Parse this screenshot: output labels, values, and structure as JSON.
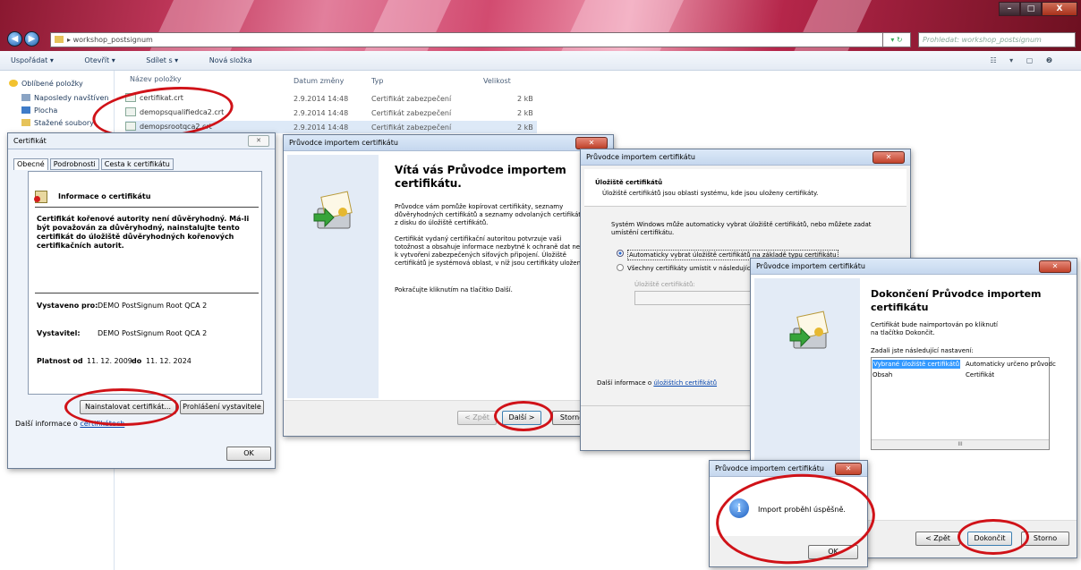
{
  "window": {
    "breadcrumb_separator": "▸",
    "path": "workshop_postsignum",
    "search_placeholder": "Prohledat: workshop_postsignum",
    "controls": {
      "minimize": "–",
      "maximize": "□",
      "close": "X"
    }
  },
  "toolbar": {
    "organize": "Uspořádat ▾",
    "open": "Otevřít ▾",
    "share": "Sdílet s ▾",
    "new_folder": "Nová složka",
    "view_icons": "☷ ▾ ▢ ❷"
  },
  "sidebar": {
    "items": [
      {
        "label": "Oblíbené položky",
        "icon": "star-icon"
      },
      {
        "label": "Naposledy navštíven",
        "icon": "recent-icon"
      },
      {
        "label": "Plocha",
        "icon": "desktop-icon"
      },
      {
        "label": "Stažené soubory",
        "icon": "downloads-icon"
      }
    ]
  },
  "file_list": {
    "columns": [
      "Název položky",
      "Datum změny",
      "Typ",
      "Velikost"
    ],
    "rows": [
      {
        "name": "certifikat.crt",
        "date": "2.9.2014 14:48",
        "type": "Certifikát zabezpečení",
        "size": "2 kB"
      },
      {
        "name": "demopsqualifiedca2.crt",
        "date": "2.9.2014 14:48",
        "type": "Certifikát zabezpečení",
        "size": "2 kB"
      },
      {
        "name": "demopsrootqca2.crt",
        "date": "2.9.2014 14:48",
        "type": "Certifikát zabezpečení",
        "size": "2 kB"
      }
    ]
  },
  "cert_dialog": {
    "title": "Certifikát",
    "tabs": [
      "Obecné",
      "Podrobnosti",
      "Cesta k certifikátu"
    ],
    "info_heading": "Informace o certifikátu",
    "warning": "Certifikát kořenové autority není důvěryhodný. Má-li být považován za důvěryhodný, nainstalujte tento certifikát do úložiště důvěryhodných kořenových certifikačních autorit.",
    "issued_to_label": "Vystaveno pro:",
    "issued_to": "DEMO PostSignum Root QCA 2",
    "issuer_label": "Vystavitel:",
    "issuer": "DEMO PostSignum Root QCA 2",
    "validity_label_from": "Platnost od",
    "valid_from": "11. 12. 2009",
    "validity_label_to": "do",
    "valid_to": "11. 12. 2024",
    "install_button": "Nainstalovat certifikát...",
    "statement_button": "Prohlášení vystavitele",
    "more_info_prefix": "Další informace o",
    "more_info_link": "certifikátech",
    "ok": "OK"
  },
  "wizard1": {
    "title": "Průvodce importem certifikátu",
    "heading": "Vítá vás Průvodce importem certifikátu.",
    "p1": "Průvodce vám pomůže kopírovat certifikáty, seznamy důvěryhodných certifikátů a seznamy odvolaných certifikátů z disku do úložiště certifikátů.",
    "p2": "Certifikát vydaný certifikační autoritou potvrzuje vaši totožnost a obsahuje informace nezbytné k ochraně dat nebo k vytvoření zabezpečených síťových připojení. Úložiště certifikátů je systémová oblast, v níž jsou certifikáty uloženy.",
    "p3": "Pokračujte kliknutím na tlačítko Další.",
    "back": "< Zpět",
    "next": "Další >",
    "cancel": "Storno"
  },
  "wizard2": {
    "title": "Průvodce importem certifikátu",
    "section": "Úložiště certifikátů",
    "section_desc": "Úložiště certifikátů jsou oblasti systému, kde jsou uloženy certifikáty.",
    "desc": "Systém Windows může automaticky vybrat úložiště certifikátů, nebo můžete zadat umístění certifikátu.",
    "opt_auto": "Automaticky vybrat úložiště certifikátů na základě typu certifikátu",
    "opt_manual": "Všechny certifikáty umístit v následující",
    "store_label": "Úložiště certifikátů:",
    "more_info_prefix": "Další informace o",
    "more_info_link": "úložištích certifikátů"
  },
  "wizard3": {
    "title": "Průvodce importem certifikátu",
    "heading": "Dokončení Průvodce importem certifikátu",
    "desc": "Certifikát bude naimportován po kliknutí na tlačítko Dokončit.",
    "settings_label": "Zadali jste následující nastavení:",
    "settings": [
      {
        "key": "Vybrané úložiště certifikátů",
        "value": "Automaticky určeno průvodc"
      },
      {
        "key": "Obsah",
        "value": "Certifikát"
      }
    ],
    "scroll_mid": "III",
    "back": "< Zpět",
    "finish": "Dokončit",
    "cancel": "Storno"
  },
  "success_dialog": {
    "title": "Průvodce importem certifikátu",
    "message": "Import proběhl úspěšně.",
    "ok": "OK",
    "icon": "info-icon"
  },
  "colors": {
    "highlight_ring": "#d01218",
    "title_gradient": "#c43a5e",
    "selection": "#3399ff"
  }
}
